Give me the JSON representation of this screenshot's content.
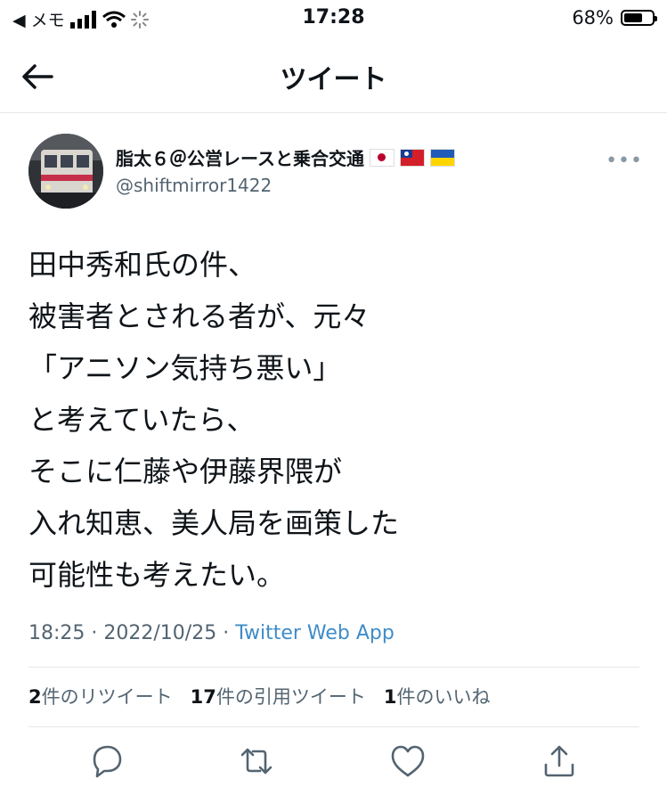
{
  "status_bar": {
    "carrier": "◀ メモ",
    "time": "17:28",
    "battery_pct": "68%",
    "battery_level": 0.68
  },
  "nav": {
    "title": "ツイート"
  },
  "tweet": {
    "display_name": "脂太６＠公営レースと乗合交通",
    "handle": "@shiftmirror1422",
    "lines": [
      "田中秀和氏の件、",
      "被害者とされる者が、元々",
      "「アニソン気持ち悪い」",
      "と考えていたら、",
      "そこに仁藤や伊藤界隈が",
      "入れ知恵、美人局を画策した",
      "可能性も考えたい。"
    ],
    "time": "18:25",
    "date": "2022/10/25",
    "source": "Twitter Web App",
    "separator": " · "
  },
  "stats": {
    "retweets_count": "2",
    "retweets_label": "件のリツイート",
    "quotes_count": "17",
    "quotes_label": "件の引用ツイート",
    "likes_count": "1",
    "likes_label": "件のいいね"
  },
  "colors": {
    "text": "#0f1419",
    "secondary": "#536471",
    "link": "#3f8cc7",
    "icon": "#536471"
  },
  "icons": [
    "back-arrow-icon",
    "more-icon",
    "reply-icon",
    "retweet-icon",
    "like-icon",
    "share-icon"
  ]
}
